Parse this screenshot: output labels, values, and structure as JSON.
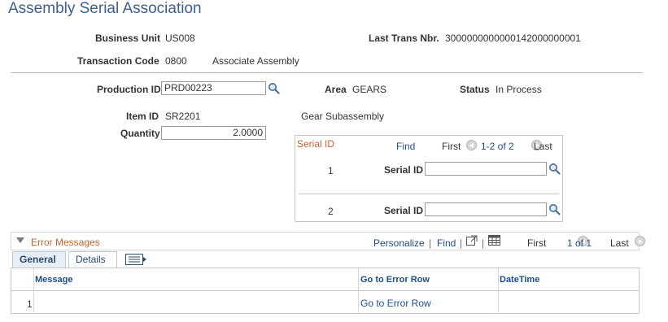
{
  "page": {
    "title": "Assembly Serial Association"
  },
  "header": {
    "business_unit_label": "Business Unit",
    "business_unit": "US008",
    "last_trans_label": "Last Trans Nbr.",
    "last_trans": "3000000000000142000000001",
    "transaction_code_label": "Transaction Code",
    "transaction_code": "0800",
    "transaction_desc": "Associate Assembly"
  },
  "production": {
    "production_id_label": "Production ID",
    "production_id": "PRD00223",
    "area_label": "Area",
    "area": "GEARS",
    "status_label": "Status",
    "status": "In Process",
    "item_id_label": "Item ID",
    "item_id": "SR2201",
    "item_desc": "Gear Subassembly",
    "quantity_label": "Quantity",
    "quantity": "2.0000"
  },
  "serial_grid": {
    "title": "Serial ID",
    "find": "Find",
    "first": "First",
    "range": "1-2 of 2",
    "last": "Last",
    "field_label": "Serial ID",
    "rows": [
      {
        "num": "1",
        "value": ""
      },
      {
        "num": "2",
        "value": ""
      }
    ]
  },
  "errors": {
    "title": "Error Messages",
    "personalize": "Personalize",
    "find": "Find",
    "separator": "|",
    "first": "First",
    "range": "1 of 1",
    "last": "Last",
    "tabs": [
      {
        "label": "General"
      },
      {
        "label": "Details"
      }
    ],
    "columns": {
      "message": "Message",
      "goto": "Go to Error Row",
      "datetime": "DateTime"
    },
    "rows": [
      {
        "num": "1",
        "message": "",
        "goto": "Go to Error Row",
        "datetime": ""
      }
    ]
  },
  "colors": {
    "title": "#3c5f8e",
    "link": "#1c4e8c",
    "section_title": "#c0622f"
  }
}
